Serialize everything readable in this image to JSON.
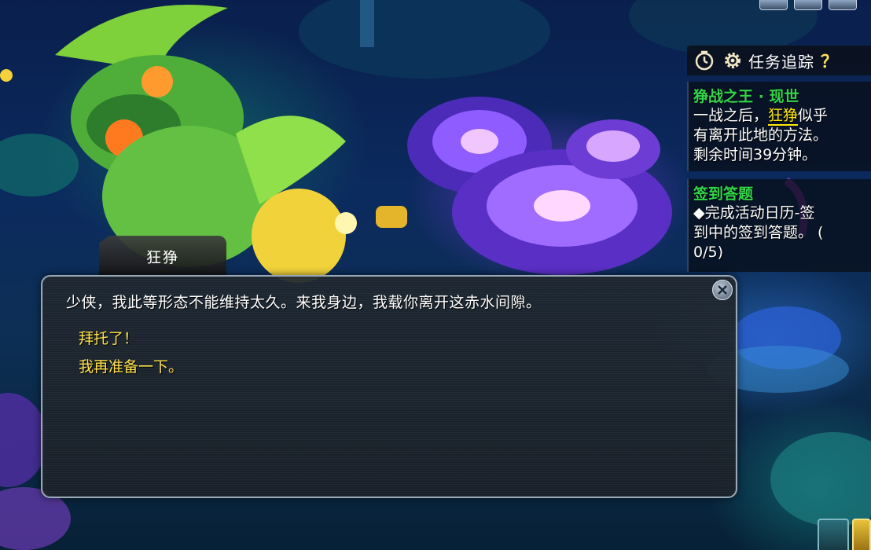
{
  "npc": {
    "name": "狂狰"
  },
  "dialog": {
    "text": "少侠，我此等形态不能维持太久。来我身边，我载你离开这赤水间隙。",
    "options": [
      {
        "label": "拜托了！"
      },
      {
        "label": "我再准备一下。"
      }
    ],
    "close_icon": "close-icon"
  },
  "tracker": {
    "title": "任务追踪",
    "help": "？",
    "icons": [
      "timer-icon",
      "gear-icon",
      "help-icon"
    ],
    "quests": [
      {
        "title": "狰战之王 · 现世",
        "title_color": "#34d64a",
        "line1_before": "一战之后，",
        "line1_highlight": "狂狰",
        "line1_after": "似乎",
        "line2": "有离开此地的方法。",
        "line3": "剩余时间39分钟。"
      },
      {
        "title": "签到答题",
        "title_color": "#34d64a",
        "line1": "◆完成活动日历-签",
        "line2": "到中的签到答题。 (",
        "line3": "0/5)"
      }
    ]
  },
  "colors": {
    "option_text": "#ffe14a",
    "highlight": "#ffe700",
    "dialog_border": "#9aa9b5"
  }
}
